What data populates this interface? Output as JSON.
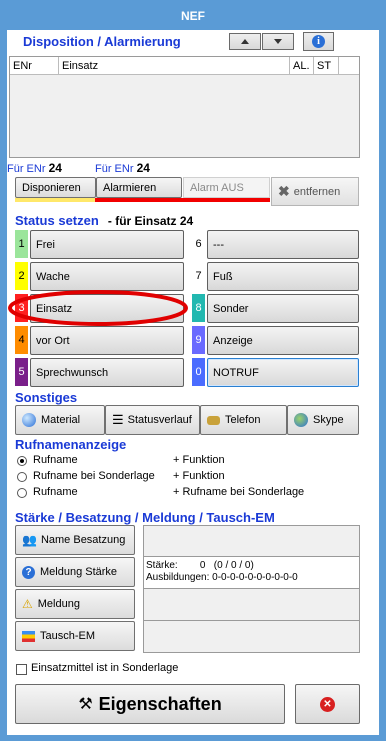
{
  "window": {
    "title": "NEF"
  },
  "disposition": {
    "title": "Disposition / Alarmierung",
    "columns": [
      "ENr",
      "Einsatz",
      "AL.",
      "ST"
    ],
    "info_icon": "info-icon"
  },
  "fuer_enr_left": {
    "label": "Für ENr",
    "value": "24"
  },
  "fuer_enr_right": {
    "label": "Für ENr",
    "value": "24"
  },
  "dispo_buttons": {
    "disponieren": "Disponieren",
    "alarmieren": "Alarmieren",
    "alarm_aus": "Alarm AUS",
    "entfernen": "entfernen"
  },
  "status": {
    "title": "Status setzen",
    "subtitle": "- für Einsatz 24",
    "items": [
      {
        "num": "1",
        "label": "Frei",
        "color": "#9be59b"
      },
      {
        "num": "2",
        "label": "Wache",
        "color": "#ffff00"
      },
      {
        "num": "3",
        "label": "Einsatz",
        "color": "#ff2020"
      },
      {
        "num": "4",
        "label": "vor Ort",
        "color": "#ff8c00"
      },
      {
        "num": "5",
        "label": "Sprechwunsch",
        "color": "#7a1f8a"
      },
      {
        "num": "6",
        "label": "---",
        "color": "#ffffff"
      },
      {
        "num": "7",
        "label": "Fuß",
        "color": "#ffffff"
      },
      {
        "num": "8",
        "label": "Sonder",
        "color": "#22b8b0"
      },
      {
        "num": "9",
        "label": "Anzeige",
        "color": "#6a6aff"
      },
      {
        "num": "0",
        "label": "NOTRUF",
        "color": "#4a6cff"
      }
    ]
  },
  "sonstiges": {
    "title": "Sonstiges",
    "buttons": [
      "Material",
      "Statusverlauf",
      "Telefon",
      "Skype"
    ]
  },
  "rufname": {
    "title": "Rufnamenanzeige",
    "options": [
      {
        "label": "Rufname",
        "extra": "+ Funktion",
        "selected": true
      },
      {
        "label": "Rufname bei Sonderlage",
        "extra": "+ Funktion",
        "selected": false
      },
      {
        "label": "Rufname",
        "extra": "+ Rufname bei Sonderlage",
        "selected": false
      }
    ]
  },
  "staerke": {
    "title": "Stärke / Besatzung / Meldung / Tausch-EM",
    "buttons": [
      "Name Besatzung",
      "Meldung Stärke",
      "Meldung",
      "Tausch-EM"
    ],
    "info_line1": "Stärke:        0   (0 / 0 / 0)",
    "info_line2": "Ausbildungen: 0-0-0-0-0-0-0-0-0-0"
  },
  "sonderlage": {
    "label": "Einsatzmittel ist in Sonderlage"
  },
  "footer": {
    "eigenschaften": "Eigenschaften"
  }
}
